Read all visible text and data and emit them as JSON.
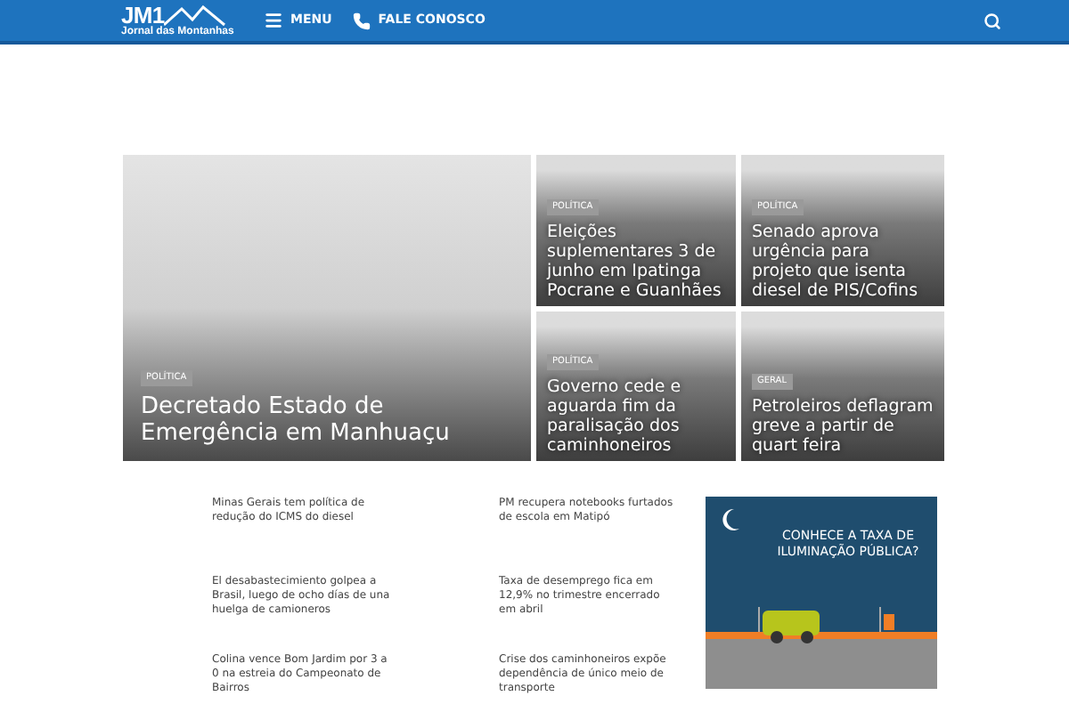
{
  "header": {
    "logo": {
      "mark": "JM1",
      "name": "Jornal das Montanhas"
    },
    "nav": [
      {
        "kind": "menu",
        "label": "MENU"
      },
      {
        "kind": "phone",
        "label": "FALE CONOSCO"
      }
    ]
  },
  "featured": [
    {
      "category": "POLÍTICA",
      "title": "Decretado Estado de Emergência em Manhuaçu"
    },
    {
      "category": "POLÍTICA",
      "title": "Eleições suplementares 3 de junho em Ipatinga Pocrane e Guanhães"
    },
    {
      "category": "POLÍTICA",
      "title": "Senado aprova urgência para projeto que isenta diesel de PIS/Cofins"
    },
    {
      "category": "POLÍTICA",
      "title": "Governo cede e aguarda fim da paralisação dos caminhoneiros"
    },
    {
      "category": "GERAL",
      "title": "Petroleiros deflagram greve a partir de quart feira"
    }
  ],
  "news": [
    "Minas Gerais tem política de redução do ICMS do diesel",
    "PM recupera notebooks furtados de escola em Matipó",
    "El desabastecimiento golpea a Brasil, luego de ocho días de una huelga de camioneros",
    "Taxa de desemprego fica em 12,9% no trimestre encerrado em abril",
    "Colina vence Bom Jardim por 3 a 0 na estreia do Campeonato de Bairros",
    "Crise dos caminhoneiros expõe dependência de único meio de transporte"
  ],
  "ad": {
    "headline": "CONHECE A TAXA DE ILUMINAÇÃO PÚBLICA?"
  }
}
